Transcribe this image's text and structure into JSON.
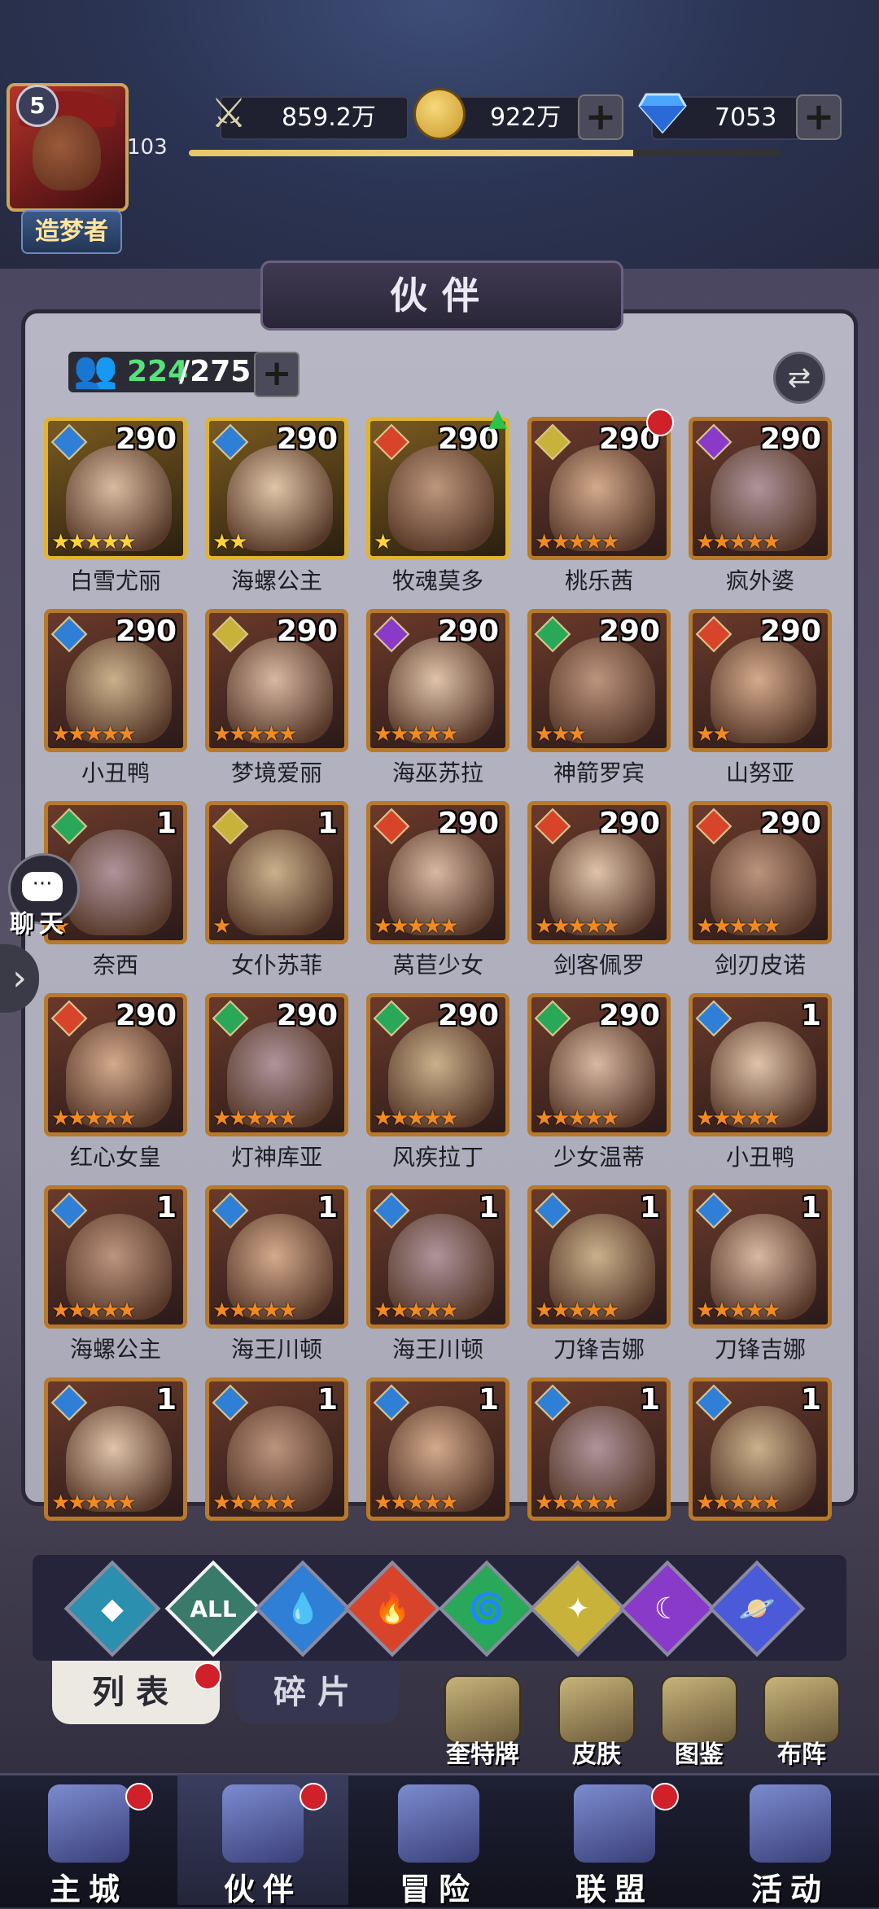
{
  "header": {
    "player_level": "5",
    "exp_level": "103",
    "title_badge": "造梦者",
    "exp_progress": 0.75,
    "power": "859.2万",
    "gold": "922万",
    "diamonds": "7053"
  },
  "panel": {
    "title": "伙伴",
    "owned": "224",
    "capacity": "/275"
  },
  "heroes": [
    {
      "name": "白雪尤丽",
      "level": "290",
      "elem": "water",
      "stars": 5,
      "rank": "gold"
    },
    {
      "name": "海螺公主",
      "level": "290",
      "elem": "water",
      "stars": 2,
      "rank": "gold"
    },
    {
      "name": "牧魂莫多",
      "level": "290",
      "elem": "fire",
      "stars": 1,
      "rank": "gold",
      "up": true
    },
    {
      "name": "桃乐茜",
      "level": "290",
      "elem": "light",
      "stars": 5,
      "rank": "red",
      "dot": true
    },
    {
      "name": "疯外婆",
      "level": "290",
      "elem": "dark",
      "stars": 5,
      "rank": "red"
    },
    {
      "name": "小丑鸭",
      "level": "290",
      "elem": "water",
      "stars": 5,
      "rank": "red"
    },
    {
      "name": "梦境爱丽",
      "level": "290",
      "elem": "light",
      "stars": 5,
      "rank": "red"
    },
    {
      "name": "海巫苏拉",
      "level": "290",
      "elem": "dark",
      "stars": 5,
      "rank": "red"
    },
    {
      "name": "神箭罗宾",
      "level": "290",
      "elem": "wind",
      "stars": 3,
      "rank": "red"
    },
    {
      "name": "山努亚",
      "level": "290",
      "elem": "fire",
      "stars": 2,
      "rank": "red"
    },
    {
      "name": "奈西",
      "level": "1",
      "elem": "wind",
      "stars": 1,
      "rank": "red"
    },
    {
      "name": "女仆苏菲",
      "level": "1",
      "elem": "light",
      "stars": 1,
      "rank": "red"
    },
    {
      "name": "莴苣少女",
      "level": "290",
      "elem": "fire",
      "stars": 5,
      "rank": "red"
    },
    {
      "name": "剑客佩罗",
      "level": "290",
      "elem": "fire",
      "stars": 5,
      "rank": "red"
    },
    {
      "name": "剑刃皮诺",
      "level": "290",
      "elem": "fire",
      "stars": 5,
      "rank": "red"
    },
    {
      "name": "红心女皇",
      "level": "290",
      "elem": "fire",
      "stars": 5,
      "rank": "red"
    },
    {
      "name": "灯神库亚",
      "level": "290",
      "elem": "wind",
      "stars": 5,
      "rank": "red"
    },
    {
      "name": "风疾拉丁",
      "level": "290",
      "elem": "wind",
      "stars": 5,
      "rank": "red"
    },
    {
      "name": "少女温蒂",
      "level": "290",
      "elem": "wind",
      "stars": 5,
      "rank": "red"
    },
    {
      "name": "小丑鸭",
      "level": "1",
      "elem": "water",
      "stars": 5,
      "rank": "red"
    },
    {
      "name": "海螺公主",
      "level": "1",
      "elem": "water",
      "stars": 5,
      "rank": "red"
    },
    {
      "name": "海王川顿",
      "level": "1",
      "elem": "water",
      "stars": 5,
      "rank": "red"
    },
    {
      "name": "海王川顿",
      "level": "1",
      "elem": "water",
      "stars": 5,
      "rank": "red"
    },
    {
      "name": "刀锋吉娜",
      "level": "1",
      "elem": "water",
      "stars": 5,
      "rank": "red"
    },
    {
      "name": "刀锋吉娜",
      "level": "1",
      "elem": "water",
      "stars": 5,
      "rank": "red"
    },
    {
      "name": "",
      "level": "1",
      "elem": "water",
      "stars": 5,
      "rank": "red"
    },
    {
      "name": "",
      "level": "1",
      "elem": "water",
      "stars": 5,
      "rank": "red"
    },
    {
      "name": "",
      "level": "1",
      "elem": "water",
      "stars": 5,
      "rank": "red"
    },
    {
      "name": "",
      "level": "1",
      "elem": "water",
      "stars": 5,
      "rank": "red"
    },
    {
      "name": "",
      "level": "1",
      "elem": "water",
      "stars": 5,
      "rank": "red"
    }
  ],
  "element_colors": {
    "water": "#2f7fd6",
    "fire": "#d8442a",
    "wind": "#2aa85a",
    "light": "#c9b23a",
    "dark": "#8a3ac9",
    "cosmic": "#4a5ad8",
    "all": "#3a7a6a"
  },
  "filters": [
    {
      "id": "rank",
      "icon": "◆",
      "color": "#2b8fb0"
    },
    {
      "id": "all",
      "icon": "ALL",
      "color": "#3a7a6a"
    },
    {
      "id": "water",
      "icon": "💧",
      "color": "#2f7fd6"
    },
    {
      "id": "fire",
      "icon": "🔥",
      "color": "#d8442a"
    },
    {
      "id": "wind",
      "icon": "🌀",
      "color": "#2aa85a"
    },
    {
      "id": "light",
      "icon": "✦",
      "color": "#c9b23a"
    },
    {
      "id": "dark",
      "icon": "☾",
      "color": "#8a3ac9"
    },
    {
      "id": "cosmic",
      "icon": "🪐",
      "color": "#4a5ad8"
    }
  ],
  "sub_tabs": {
    "list": "列表",
    "fragments": "碎片"
  },
  "actions": [
    {
      "label": "奎特牌",
      "icon": "card-deck-icon"
    },
    {
      "label": "皮肤",
      "icon": "outfit-icon"
    },
    {
      "label": "图鉴",
      "icon": "codex-icon"
    },
    {
      "label": "布阵",
      "icon": "chess-icon"
    }
  ],
  "chat_label": "聊天",
  "nav": [
    {
      "label": "主城",
      "icon": "castle-icon",
      "dot": true
    },
    {
      "label": "伙伴",
      "icon": "hat-icon",
      "dot": true,
      "active": true
    },
    {
      "label": "冒险",
      "icon": "compass-icon",
      "dot": false
    },
    {
      "label": "联盟",
      "icon": "shield-icon",
      "dot": true
    },
    {
      "label": "活动",
      "icon": "cards-icon",
      "dot": false
    }
  ]
}
